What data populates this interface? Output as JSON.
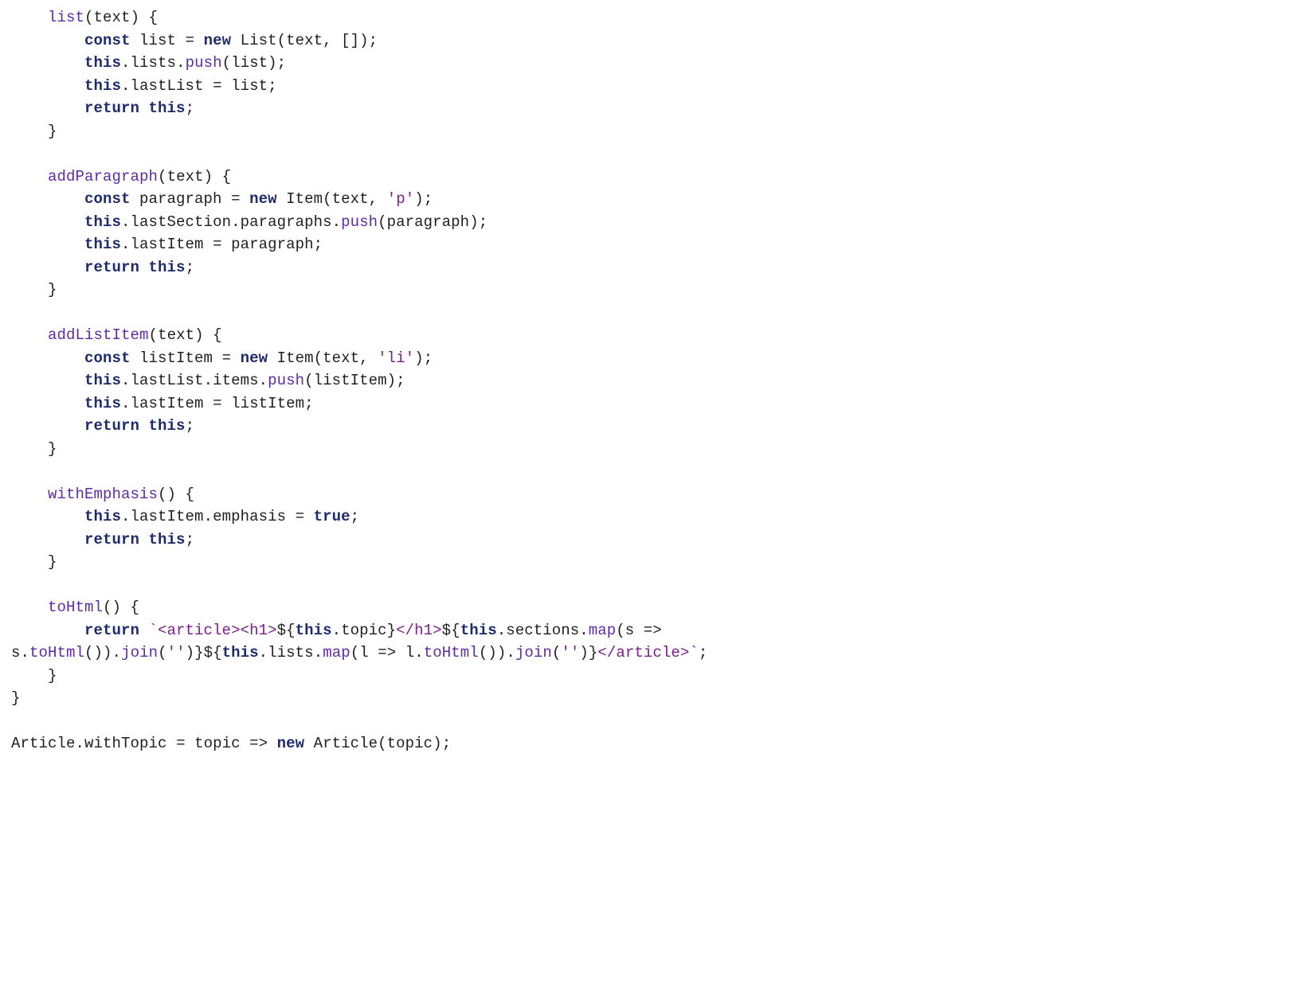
{
  "code": {
    "lines": [
      [
        {
          "t": "    ",
          "c": "p"
        },
        {
          "t": "list",
          "c": "fn"
        },
        {
          "t": "(",
          "c": "p"
        },
        {
          "t": "text",
          "c": "v"
        },
        {
          "t": ") {",
          "c": "p"
        }
      ],
      [
        {
          "t": "        ",
          "c": "p"
        },
        {
          "t": "const",
          "c": "k"
        },
        {
          "t": " ",
          "c": "p"
        },
        {
          "t": "list",
          "c": "v"
        },
        {
          "t": " = ",
          "c": "p"
        },
        {
          "t": "new",
          "c": "k"
        },
        {
          "t": " ",
          "c": "p"
        },
        {
          "t": "List",
          "c": "cls"
        },
        {
          "t": "(",
          "c": "p"
        },
        {
          "t": "text",
          "c": "v"
        },
        {
          "t": ", []);",
          "c": "p"
        }
      ],
      [
        {
          "t": "        ",
          "c": "p"
        },
        {
          "t": "this",
          "c": "k"
        },
        {
          "t": ".",
          "c": "p"
        },
        {
          "t": "lists",
          "c": "pr"
        },
        {
          "t": ".",
          "c": "p"
        },
        {
          "t": "push",
          "c": "fn"
        },
        {
          "t": "(",
          "c": "p"
        },
        {
          "t": "list",
          "c": "v"
        },
        {
          "t": ");",
          "c": "p"
        }
      ],
      [
        {
          "t": "        ",
          "c": "p"
        },
        {
          "t": "this",
          "c": "k"
        },
        {
          "t": ".",
          "c": "p"
        },
        {
          "t": "lastList",
          "c": "pr"
        },
        {
          "t": " = ",
          "c": "p"
        },
        {
          "t": "list",
          "c": "v"
        },
        {
          "t": ";",
          "c": "p"
        }
      ],
      [
        {
          "t": "        ",
          "c": "p"
        },
        {
          "t": "return",
          "c": "k"
        },
        {
          "t": " ",
          "c": "p"
        },
        {
          "t": "this",
          "c": "k"
        },
        {
          "t": ";",
          "c": "p"
        }
      ],
      [
        {
          "t": "    }",
          "c": "p"
        }
      ],
      [
        {
          "t": "",
          "c": "p"
        }
      ],
      [
        {
          "t": "    ",
          "c": "p"
        },
        {
          "t": "addParagraph",
          "c": "fn"
        },
        {
          "t": "(",
          "c": "p"
        },
        {
          "t": "text",
          "c": "v"
        },
        {
          "t": ") {",
          "c": "p"
        }
      ],
      [
        {
          "t": "        ",
          "c": "p"
        },
        {
          "t": "const",
          "c": "k"
        },
        {
          "t": " ",
          "c": "p"
        },
        {
          "t": "paragraph",
          "c": "v"
        },
        {
          "t": " = ",
          "c": "p"
        },
        {
          "t": "new",
          "c": "k"
        },
        {
          "t": " ",
          "c": "p"
        },
        {
          "t": "Item",
          "c": "cls"
        },
        {
          "t": "(",
          "c": "p"
        },
        {
          "t": "text",
          "c": "v"
        },
        {
          "t": ", ",
          "c": "p"
        },
        {
          "t": "'p'",
          "c": "s"
        },
        {
          "t": ");",
          "c": "p"
        }
      ],
      [
        {
          "t": "        ",
          "c": "p"
        },
        {
          "t": "this",
          "c": "k"
        },
        {
          "t": ".",
          "c": "p"
        },
        {
          "t": "lastSection",
          "c": "pr"
        },
        {
          "t": ".",
          "c": "p"
        },
        {
          "t": "paragraphs",
          "c": "pr"
        },
        {
          "t": ".",
          "c": "p"
        },
        {
          "t": "push",
          "c": "fn"
        },
        {
          "t": "(",
          "c": "p"
        },
        {
          "t": "paragraph",
          "c": "v"
        },
        {
          "t": ");",
          "c": "p"
        }
      ],
      [
        {
          "t": "        ",
          "c": "p"
        },
        {
          "t": "this",
          "c": "k"
        },
        {
          "t": ".",
          "c": "p"
        },
        {
          "t": "lastItem",
          "c": "pr"
        },
        {
          "t": " = ",
          "c": "p"
        },
        {
          "t": "paragraph",
          "c": "v"
        },
        {
          "t": ";",
          "c": "p"
        }
      ],
      [
        {
          "t": "        ",
          "c": "p"
        },
        {
          "t": "return",
          "c": "k"
        },
        {
          "t": " ",
          "c": "p"
        },
        {
          "t": "this",
          "c": "k"
        },
        {
          "t": ";",
          "c": "p"
        }
      ],
      [
        {
          "t": "    }",
          "c": "p"
        }
      ],
      [
        {
          "t": "",
          "c": "p"
        }
      ],
      [
        {
          "t": "    ",
          "c": "p"
        },
        {
          "t": "addListItem",
          "c": "fn"
        },
        {
          "t": "(",
          "c": "p"
        },
        {
          "t": "text",
          "c": "v"
        },
        {
          "t": ") {",
          "c": "p"
        }
      ],
      [
        {
          "t": "        ",
          "c": "p"
        },
        {
          "t": "const",
          "c": "k"
        },
        {
          "t": " ",
          "c": "p"
        },
        {
          "t": "listItem",
          "c": "v"
        },
        {
          "t": " = ",
          "c": "p"
        },
        {
          "t": "new",
          "c": "k"
        },
        {
          "t": " ",
          "c": "p"
        },
        {
          "t": "Item",
          "c": "cls"
        },
        {
          "t": "(",
          "c": "p"
        },
        {
          "t": "text",
          "c": "v"
        },
        {
          "t": ", ",
          "c": "p"
        },
        {
          "t": "'li'",
          "c": "s"
        },
        {
          "t": ");",
          "c": "p"
        }
      ],
      [
        {
          "t": "        ",
          "c": "p"
        },
        {
          "t": "this",
          "c": "k"
        },
        {
          "t": ".",
          "c": "p"
        },
        {
          "t": "lastList",
          "c": "pr"
        },
        {
          "t": ".",
          "c": "p"
        },
        {
          "t": "items",
          "c": "pr"
        },
        {
          "t": ".",
          "c": "p"
        },
        {
          "t": "push",
          "c": "fn"
        },
        {
          "t": "(",
          "c": "p"
        },
        {
          "t": "listItem",
          "c": "v"
        },
        {
          "t": ");",
          "c": "p"
        }
      ],
      [
        {
          "t": "        ",
          "c": "p"
        },
        {
          "t": "this",
          "c": "k"
        },
        {
          "t": ".",
          "c": "p"
        },
        {
          "t": "lastItem",
          "c": "pr"
        },
        {
          "t": " = ",
          "c": "p"
        },
        {
          "t": "listItem",
          "c": "v"
        },
        {
          "t": ";",
          "c": "p"
        }
      ],
      [
        {
          "t": "        ",
          "c": "p"
        },
        {
          "t": "return",
          "c": "k"
        },
        {
          "t": " ",
          "c": "p"
        },
        {
          "t": "this",
          "c": "k"
        },
        {
          "t": ";",
          "c": "p"
        }
      ],
      [
        {
          "t": "    }",
          "c": "p"
        }
      ],
      [
        {
          "t": "",
          "c": "p"
        }
      ],
      [
        {
          "t": "    ",
          "c": "p"
        },
        {
          "t": "withEmphasis",
          "c": "fn"
        },
        {
          "t": "() {",
          "c": "p"
        }
      ],
      [
        {
          "t": "        ",
          "c": "p"
        },
        {
          "t": "this",
          "c": "k"
        },
        {
          "t": ".",
          "c": "p"
        },
        {
          "t": "lastItem",
          "c": "pr"
        },
        {
          "t": ".",
          "c": "p"
        },
        {
          "t": "emphasis",
          "c": "pr"
        },
        {
          "t": " = ",
          "c": "p"
        },
        {
          "t": "true",
          "c": "b"
        },
        {
          "t": ";",
          "c": "p"
        }
      ],
      [
        {
          "t": "        ",
          "c": "p"
        },
        {
          "t": "return",
          "c": "k"
        },
        {
          "t": " ",
          "c": "p"
        },
        {
          "t": "this",
          "c": "k"
        },
        {
          "t": ";",
          "c": "p"
        }
      ],
      [
        {
          "t": "    }",
          "c": "p"
        }
      ],
      [
        {
          "t": "",
          "c": "p"
        }
      ],
      [
        {
          "t": "    ",
          "c": "p"
        },
        {
          "t": "toHtml",
          "c": "fn"
        },
        {
          "t": "() {",
          "c": "p"
        }
      ],
      [
        {
          "t": "        ",
          "c": "p"
        },
        {
          "t": "return",
          "c": "k"
        },
        {
          "t": " ",
          "c": "p"
        },
        {
          "t": "`<article><h1>",
          "c": "s"
        },
        {
          "t": "${",
          "c": "p"
        },
        {
          "t": "this",
          "c": "k"
        },
        {
          "t": ".",
          "c": "p"
        },
        {
          "t": "topic",
          "c": "pr"
        },
        {
          "t": "}",
          "c": "p"
        },
        {
          "t": "</h1>",
          "c": "s"
        },
        {
          "t": "${",
          "c": "p"
        },
        {
          "t": "this",
          "c": "k"
        },
        {
          "t": ".",
          "c": "p"
        },
        {
          "t": "sections",
          "c": "pr"
        },
        {
          "t": ".",
          "c": "p"
        },
        {
          "t": "map",
          "c": "fn"
        },
        {
          "t": "(",
          "c": "p"
        },
        {
          "t": "s",
          "c": "v"
        },
        {
          "t": " => ",
          "c": "p"
        }
      ],
      [
        {
          "t": "s",
          "c": "v"
        },
        {
          "t": ".",
          "c": "p"
        },
        {
          "t": "toHtml",
          "c": "fn"
        },
        {
          "t": "()).",
          "c": "p"
        },
        {
          "t": "join",
          "c": "fn"
        },
        {
          "t": "(",
          "c": "p"
        },
        {
          "t": "''",
          "c": "s"
        },
        {
          "t": ")}",
          "c": "p"
        },
        {
          "t": "${",
          "c": "p"
        },
        {
          "t": "this",
          "c": "k"
        },
        {
          "t": ".",
          "c": "p"
        },
        {
          "t": "lists",
          "c": "pr"
        },
        {
          "t": ".",
          "c": "p"
        },
        {
          "t": "map",
          "c": "fn"
        },
        {
          "t": "(",
          "c": "p"
        },
        {
          "t": "l",
          "c": "v"
        },
        {
          "t": " => ",
          "c": "p"
        },
        {
          "t": "l",
          "c": "v"
        },
        {
          "t": ".",
          "c": "p"
        },
        {
          "t": "toHtml",
          "c": "fn"
        },
        {
          "t": "()).",
          "c": "p"
        },
        {
          "t": "join",
          "c": "fn"
        },
        {
          "t": "(",
          "c": "p"
        },
        {
          "t": "''",
          "c": "s"
        },
        {
          "t": ")}",
          "c": "p"
        },
        {
          "t": "</article>`",
          "c": "s"
        },
        {
          "t": ";",
          "c": "p"
        }
      ],
      [
        {
          "t": "    }",
          "c": "p"
        }
      ],
      [
        {
          "t": "}",
          "c": "p"
        }
      ],
      [
        {
          "t": "",
          "c": "p"
        }
      ],
      [
        {
          "t": "Article",
          "c": "cls"
        },
        {
          "t": ".",
          "c": "p"
        },
        {
          "t": "withTopic",
          "c": "pr"
        },
        {
          "t": " = ",
          "c": "p"
        },
        {
          "t": "topic",
          "c": "v"
        },
        {
          "t": " => ",
          "c": "p"
        },
        {
          "t": "new",
          "c": "k"
        },
        {
          "t": " ",
          "c": "p"
        },
        {
          "t": "Article",
          "c": "cls"
        },
        {
          "t": "(",
          "c": "p"
        },
        {
          "t": "topic",
          "c": "v"
        },
        {
          "t": ");",
          "c": "p"
        }
      ]
    ]
  }
}
